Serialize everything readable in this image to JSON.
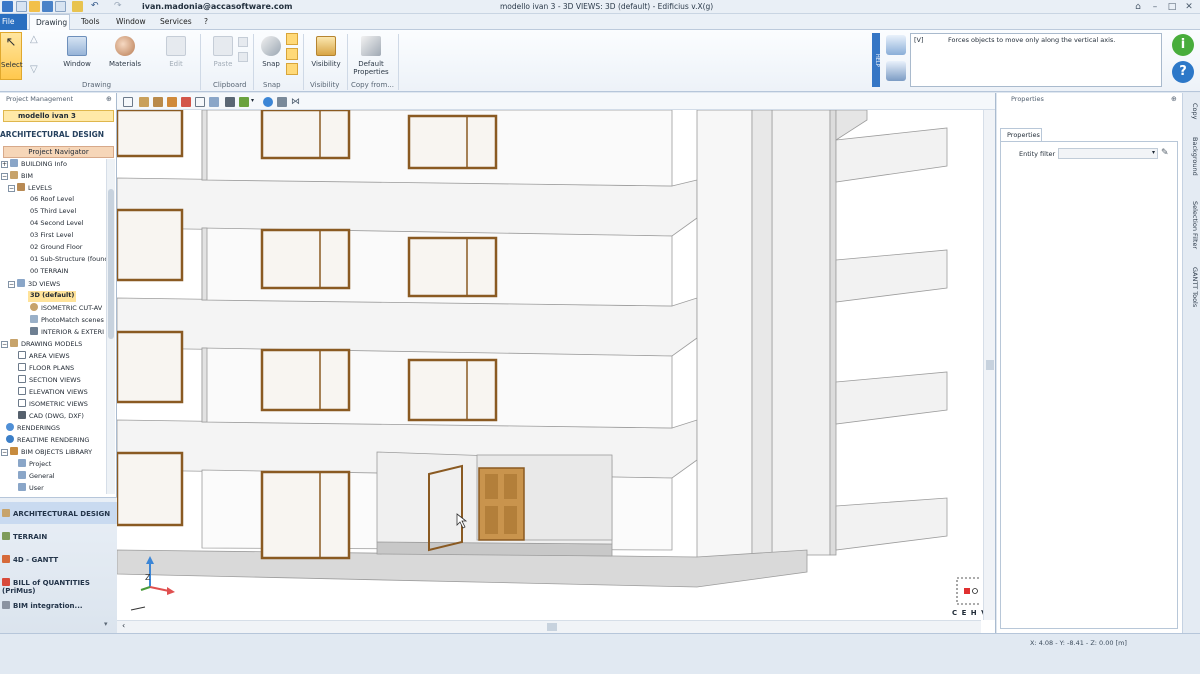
{
  "titlebar": {
    "user": "ivan.madonia@accasoftware.com",
    "title": "modello ivan 3 -  3D VIEWS: 3D (default) - Edificius v.X(g)"
  },
  "menu": {
    "file": "File",
    "drawing": "Drawing",
    "tools": "Tools",
    "window": "Window",
    "services": "Services",
    "help": "?"
  },
  "ribbon": {
    "select": "Select",
    "window": "Window",
    "materials": "Materials",
    "edit": "Edit",
    "paste": "Paste",
    "snap": "Snap",
    "visibility": "Visibility",
    "default_properties_1": "Default",
    "default_properties_2": "Properties",
    "groups": {
      "drawing": "Drawing",
      "clipboard": "Clipboard",
      "snap": "Snap",
      "visibility": "Visibility",
      "copy_from": "Copy from..."
    },
    "hint_key": "[V]",
    "hint_text": "Forces objects to move only along the vertical axis.",
    "help_strip": "HELP"
  },
  "left_panel": {
    "header": "Project Management",
    "project": "modello ivan 3",
    "section_title": "ARCHITECTURAL DESIGN",
    "navigator": "Project Navigator",
    "tree": [
      {
        "label": "BUILDING Info",
        "indent": 0
      },
      {
        "label": "BIM",
        "indent": 0
      },
      {
        "label": "LEVELS",
        "indent": 1
      },
      {
        "label": "06 Roof Level",
        "indent": 2
      },
      {
        "label": "05 Third Level",
        "indent": 2
      },
      {
        "label": "04 Second Level",
        "indent": 2
      },
      {
        "label": "03 First Level",
        "indent": 2
      },
      {
        "label": "02 Ground Floor",
        "indent": 2
      },
      {
        "label": "01 Sub-Structure (founc",
        "indent": 2
      },
      {
        "label": "00 TERRAIN",
        "indent": 2
      },
      {
        "label": "3D VIEWS",
        "indent": 1
      },
      {
        "label": "3D (default)",
        "indent": 2
      },
      {
        "label": "ISOMETRIC CUT-AV",
        "indent": 2
      },
      {
        "label": "PhotoMatch scenes",
        "indent": 2
      },
      {
        "label": "INTERIOR & EXTERI",
        "indent": 2
      },
      {
        "label": "DRAWING MODELS",
        "indent": 0
      },
      {
        "label": "AREA VIEWS",
        "indent": 1
      },
      {
        "label": "FLOOR PLANS",
        "indent": 1
      },
      {
        "label": "SECTION VIEWS",
        "indent": 1
      },
      {
        "label": "ELEVATION VIEWS",
        "indent": 1
      },
      {
        "label": "ISOMETRIC VIEWS",
        "indent": 1
      },
      {
        "label": "CAD (DWG, DXF)",
        "indent": 1
      },
      {
        "label": "RENDERINGS",
        "indent": 0
      },
      {
        "label": "REALTIME RENDERING",
        "indent": 0
      },
      {
        "label": "BIM OBJECTS LIBRARY",
        "indent": 0
      },
      {
        "label": "Project",
        "indent": 1
      },
      {
        "label": "General",
        "indent": 1
      },
      {
        "label": "User",
        "indent": 1
      }
    ],
    "modules": [
      "ARCHITECTURAL DESIGN",
      "TERRAIN",
      "4D - GANTT",
      "BILL of QUANTITIES (PriMus)",
      "BIM integration..."
    ]
  },
  "right_panel": {
    "header": "Properties",
    "tab": "Properties",
    "filter_label": "Entity filter"
  },
  "side_tabs": [
    "Copy",
    "Background",
    "Selection Filter",
    "GANTT Tools"
  ],
  "view_cube": {
    "labels": "C E H V"
  },
  "status": {
    "coords": "X: 4.08 - Y: -8.41 - Z: 0.00 [m]"
  }
}
